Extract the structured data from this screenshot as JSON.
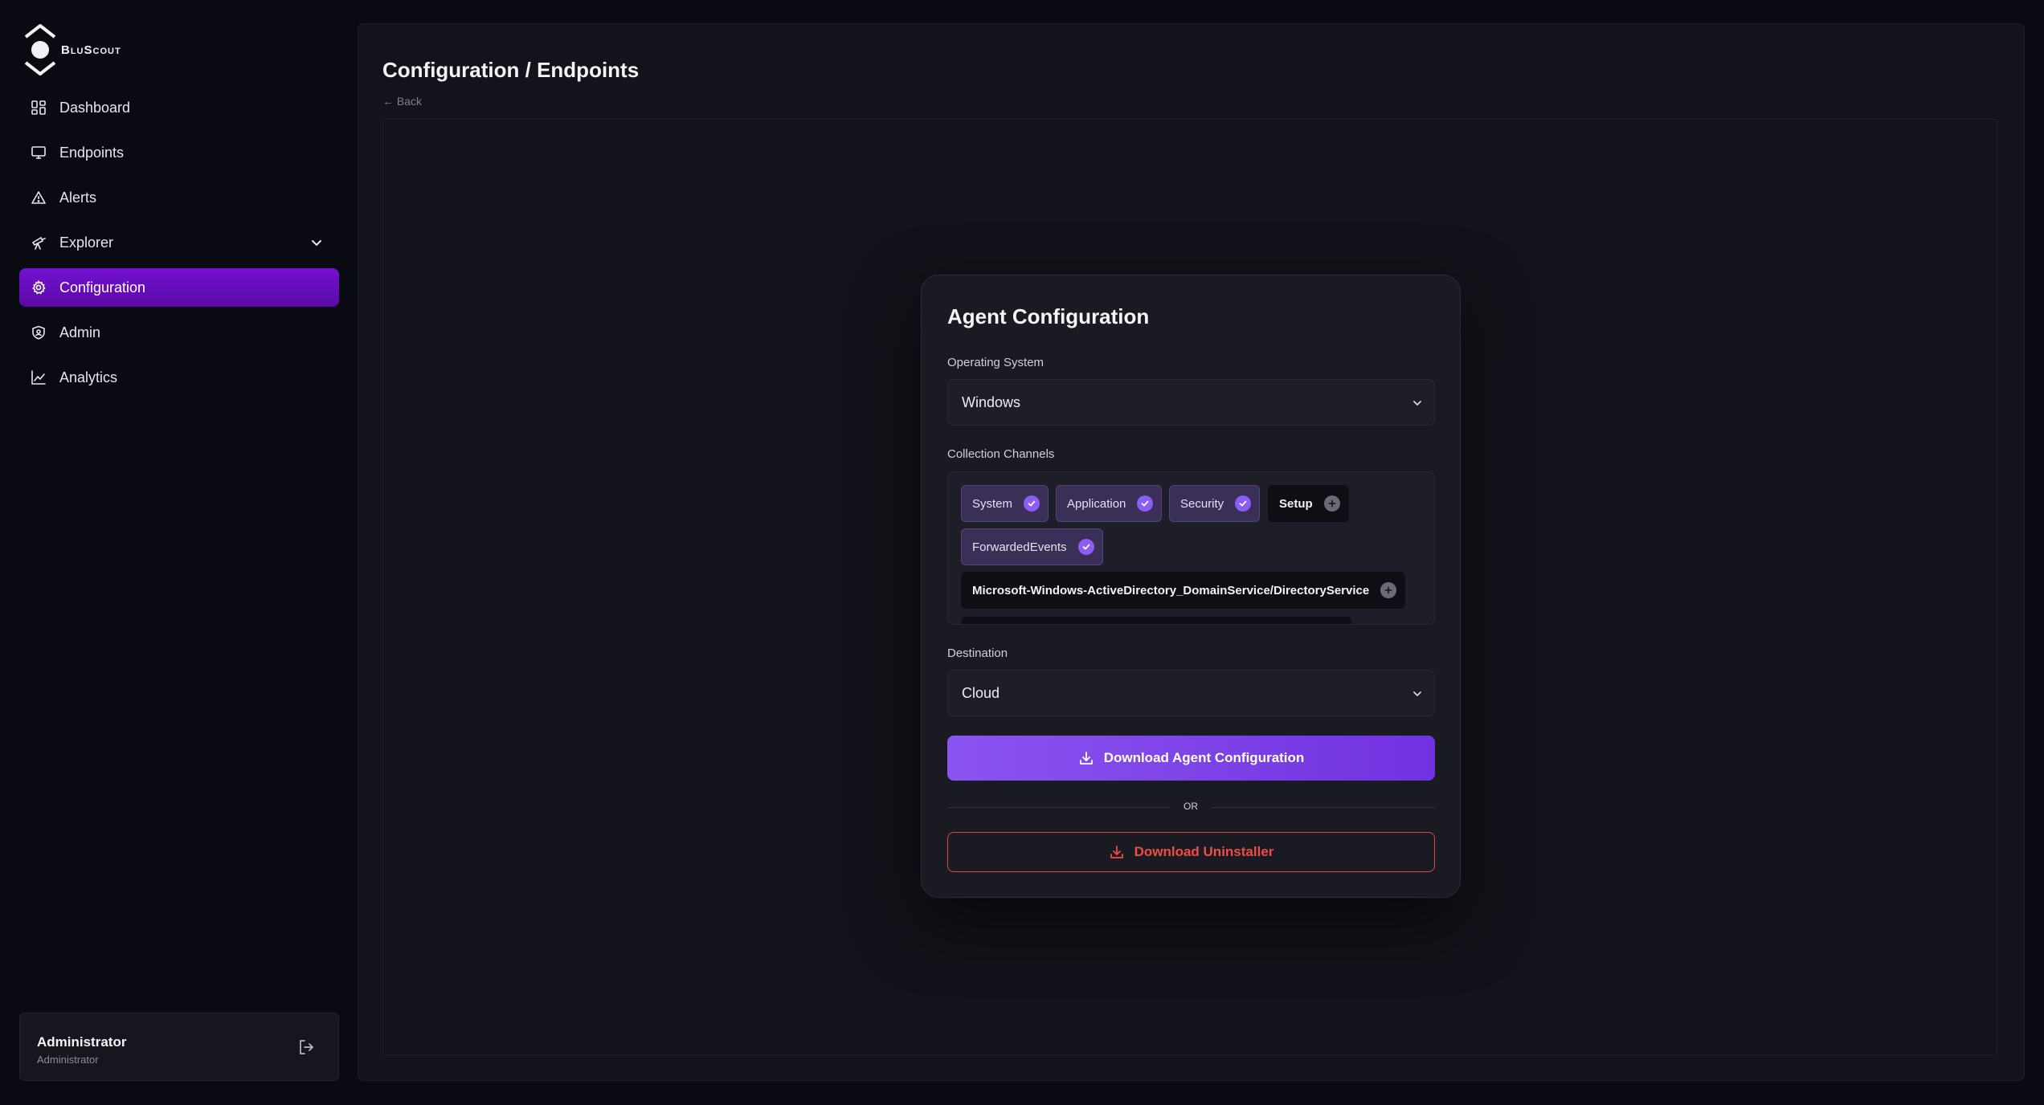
{
  "brand": {
    "name": "BluScout",
    "icon": "hexagon-logo-icon"
  },
  "sidebar": {
    "items": [
      {
        "label": "Dashboard",
        "icon": "dashboard-grid-icon"
      },
      {
        "label": "Endpoints",
        "icon": "monitor-icon"
      },
      {
        "label": "Alerts",
        "icon": "warning-triangle-icon"
      },
      {
        "label": "Explorer",
        "icon": "telescope-icon",
        "expandable": true
      },
      {
        "label": "Configuration",
        "icon": "gear-icon",
        "active": true
      },
      {
        "label": "Admin",
        "icon": "shield-icon"
      },
      {
        "label": "Analytics",
        "icon": "chart-line-icon"
      }
    ],
    "user": {
      "name": "Administrator",
      "role": "Administrator",
      "logout_icon": "logout-icon"
    }
  },
  "header": {
    "title": "Configuration / Endpoints",
    "back_label": "← Back"
  },
  "card": {
    "title": "Agent Configuration",
    "os_label": "Operating System",
    "os_value": "Windows",
    "channels_label": "Collection Channels",
    "channels": [
      {
        "label": "System",
        "selected": true
      },
      {
        "label": "Application",
        "selected": true
      },
      {
        "label": "Security",
        "selected": true
      },
      {
        "label": "Setup",
        "selected": false
      },
      {
        "label": "ForwardedEvents",
        "selected": true
      },
      {
        "label": "Microsoft-Windows-ActiveDirectory_DomainService/DirectoryService",
        "selected": false
      }
    ],
    "destination_label": "Destination",
    "destination_value": "Cloud",
    "download_config_label": "Download Agent Configuration",
    "or_label": "OR",
    "download_uninstaller_label": "Download Uninstaller"
  },
  "colors": {
    "accent": "#8b5cf6",
    "active_nav": "#7411d1",
    "danger": "#ef4d45",
    "background": "#0a0a12"
  }
}
